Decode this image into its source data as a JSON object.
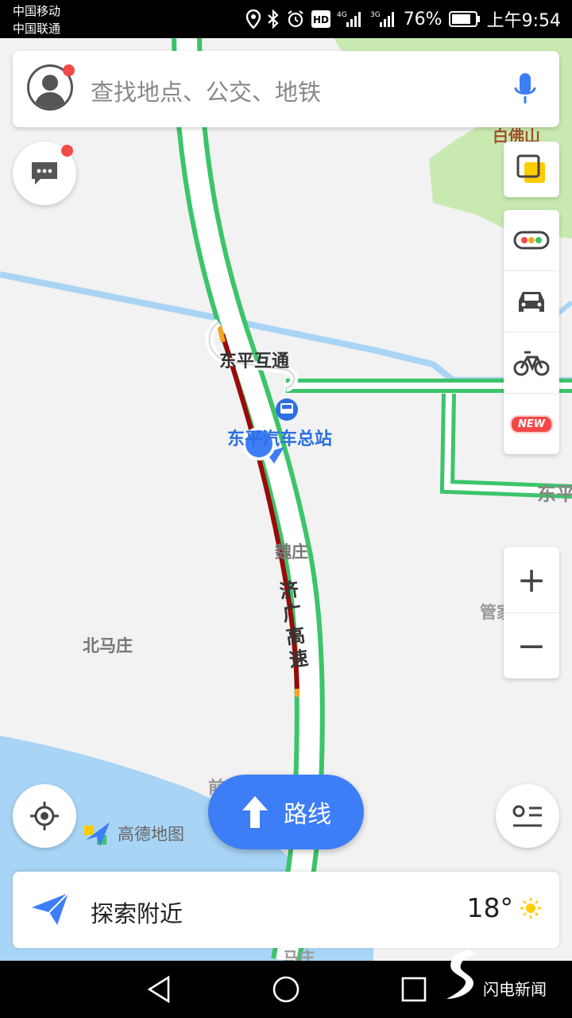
{
  "status_bar": {
    "carrier1": "中国移动",
    "carrier2": "中国联通",
    "battery": "76%",
    "time": "上午9:54"
  },
  "search": {
    "placeholder": "查找地点、公交、地铁"
  },
  "map": {
    "labels": {
      "interchange": "东平互通",
      "bus_station": "东平汽车总站",
      "village_wei": "魏庄",
      "highway": "济广高速",
      "village_beima": "北马庄",
      "baifo": "白佛山",
      "dongping_edge": "东平",
      "guan_edge": "管家",
      "qian_edge": "前",
      "bottom_edge": "马庄"
    }
  },
  "route_button": {
    "label": "路线"
  },
  "brand": {
    "logo_text": "高德地图"
  },
  "explore": {
    "label": "探索附近",
    "temperature": "18°"
  },
  "side_panel": {
    "new_badge": "NEW"
  },
  "zoom": {
    "in": "+",
    "out": "−"
  },
  "watermark": {
    "text": "闪电新闻"
  },
  "colors": {
    "accent": "#3d7ef6",
    "road_green": "#3cc46a",
    "congestion": "#9a0a0a",
    "water": "#a8d4f5",
    "park": "#c8eab0"
  }
}
